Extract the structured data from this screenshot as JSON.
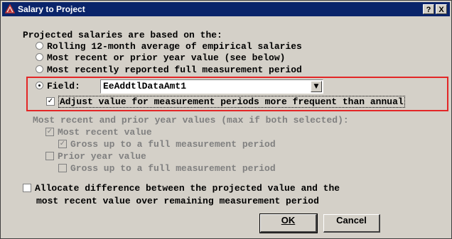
{
  "window": {
    "title": "Salary to Project",
    "help_label": "?",
    "close_label": "X"
  },
  "intro": "Projected salaries are based on the:",
  "options": [
    {
      "label": "Rolling 12-month average of empirical salaries",
      "selected": false
    },
    {
      "label": "Most recent or prior year value (see below)",
      "selected": false
    },
    {
      "label": "Most recently reported full measurement period",
      "selected": false
    }
  ],
  "field": {
    "label": "Field:",
    "value": "EeAddtlDataAmt1",
    "selected": true
  },
  "adjust": {
    "label": "Adjust value for measurement periods more frequent than annual",
    "checked": true
  },
  "recent_prior": {
    "header": "Most recent and prior year values (max if both selected):",
    "most_recent_label": "Most recent value",
    "most_recent_checked": true,
    "gross_up_1_label": "Gross up to a full measurement period",
    "gross_up_1_checked": true,
    "prior_year_label": "Prior year value",
    "prior_year_checked": false,
    "gross_up_2_label": "Gross up to a full measurement period",
    "gross_up_2_checked": false
  },
  "allocate": {
    "line1": "Allocate difference between the projected value and the",
    "line2": "most recent value over remaining measurement period",
    "checked": false
  },
  "buttons": {
    "ok": "OK",
    "cancel": "Cancel"
  },
  "colors": {
    "titlebar": "#0a246a",
    "dialog_bg": "#d4d0c8",
    "highlight": "#e32626"
  }
}
